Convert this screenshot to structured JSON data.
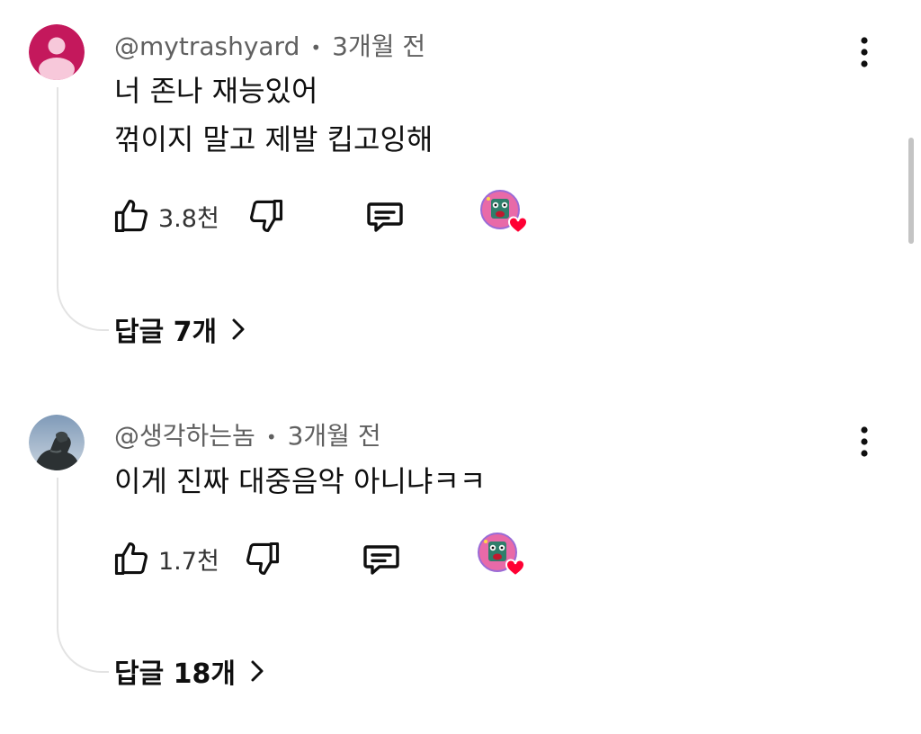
{
  "comments": [
    {
      "author": "@mytrashyard",
      "time": "3개월 전",
      "lines": [
        "너 존나 재능있어",
        "꺾이지 말고 제발 킵고잉해"
      ],
      "likes": "3.8천",
      "replies": "답글 7개"
    },
    {
      "author": "@생각하는놈",
      "time": "3개월 전",
      "lines": [
        "이게 진짜 대중음악 아니냐ㅋㅋ"
      ],
      "likes": "1.7천",
      "replies": "답글 18개"
    }
  ],
  "separator": "•",
  "colors": {
    "avatar1": "#c4185c",
    "heart": "#ff0033",
    "meta_text": "#606060",
    "thread_line": "#e3e3e3"
  },
  "icons": [
    "person-avatar-icon",
    "like-icon",
    "dislike-icon",
    "reply-icon",
    "creator-heart-icon",
    "more-vert-icon",
    "chevron-right-icon"
  ]
}
